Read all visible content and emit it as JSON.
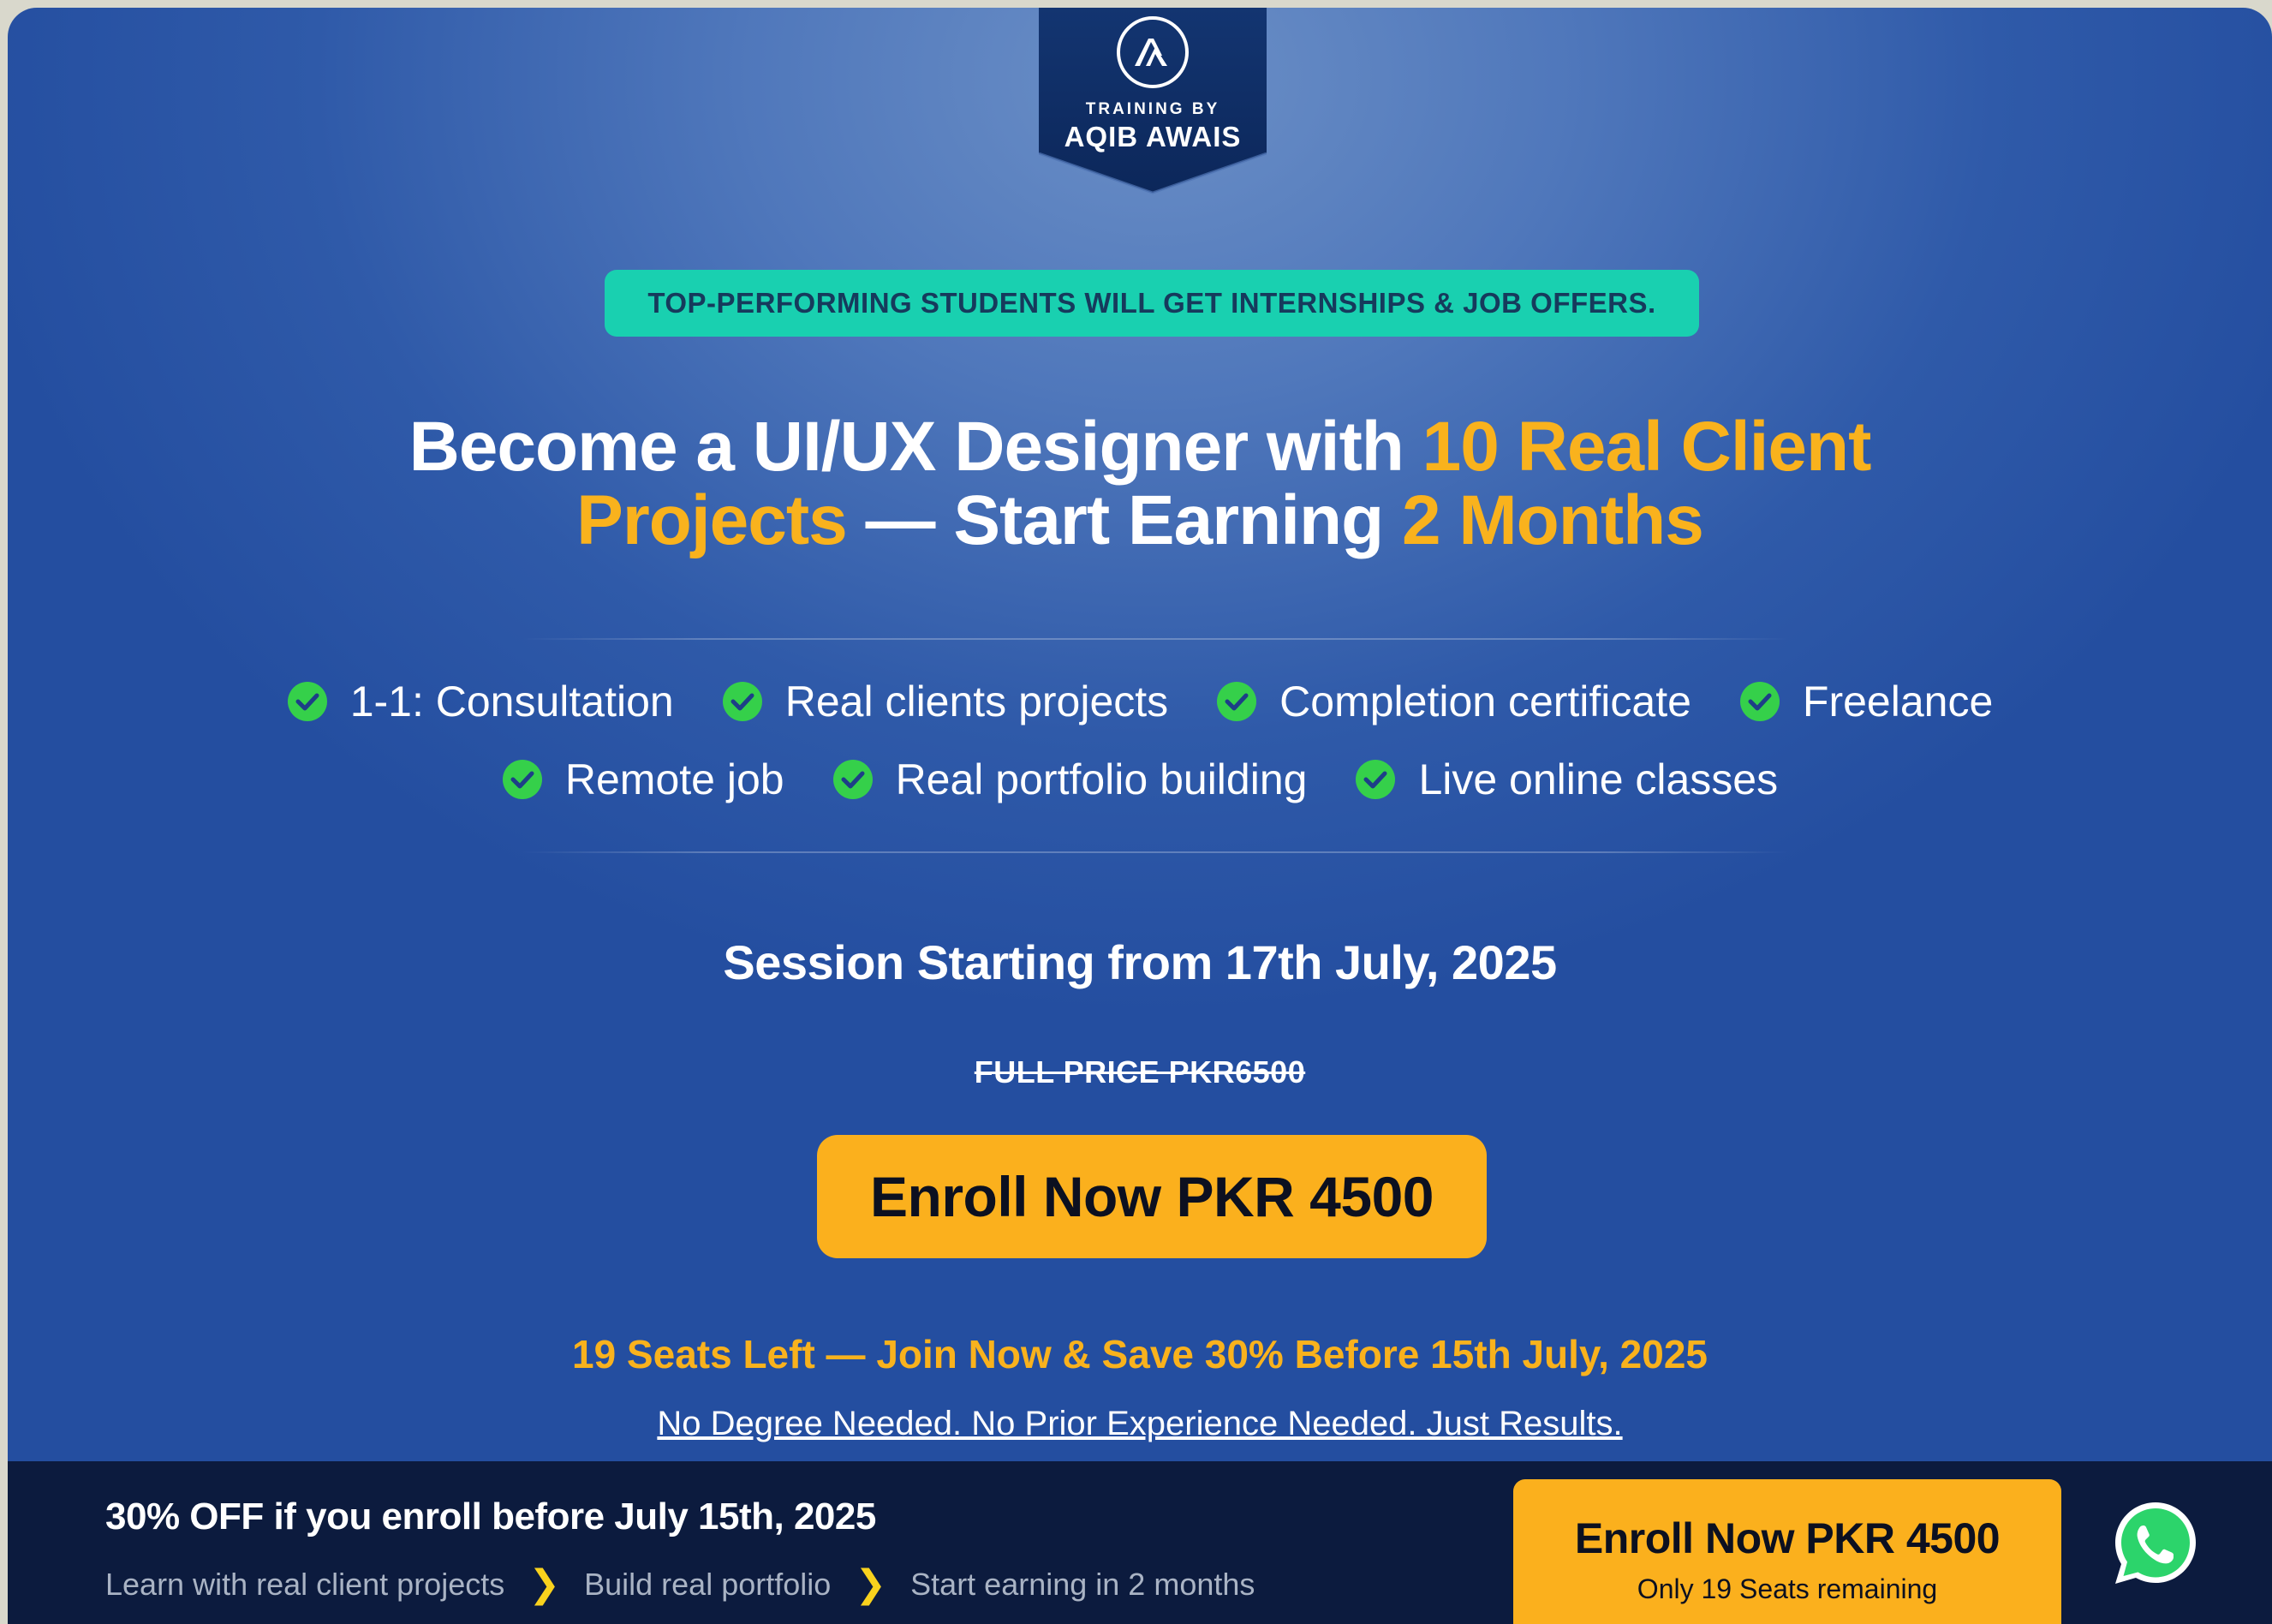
{
  "brand": {
    "small_text": "TRAINING BY",
    "name": "AQIB AWAIS",
    "logo_icon": "aqib-awais-logo-icon",
    "badge_color": "#0f2d64"
  },
  "announcement": "TOP-PERFORMING STUDENTS WILL GET INTERNSHIPS & JOB OFFERS.",
  "headline": {
    "part1": "Become a UI/UX Designer with ",
    "highlight1": "10 Real Client",
    "highlight2": "Projects",
    "part2": " — Start Earning ",
    "highlight3": "2 Months"
  },
  "features": {
    "row1": [
      {
        "label": "1-1: Consultation",
        "icon": "check-circle-icon"
      },
      {
        "label": "Real clients projects",
        "icon": "check-circle-icon"
      },
      {
        "label": "Completion certificate",
        "icon": "check-circle-icon"
      },
      {
        "label": "Freelance",
        "icon": "check-circle-icon"
      }
    ],
    "row2": [
      {
        "label": "Remote job",
        "icon": "check-circle-icon"
      },
      {
        "label": "Real portfolio building",
        "icon": "check-circle-icon"
      },
      {
        "label": "Live online classes",
        "icon": "check-circle-icon"
      }
    ]
  },
  "session": "Session Starting from 17th July, 2025",
  "full_price": "FULL PRICE PKR6500",
  "enroll_main_label": "Enroll Now PKR 4500",
  "seats_notice": "19 Seats Left — Join Now & Save 30% Before 15th July, 2025",
  "no_degree_link": "No Degree Needed. No Prior Experience Needed. Just Results.",
  "bottom_bar": {
    "title": "30% OFF if you enroll before July 15th, 2025",
    "steps": [
      "Learn with real client projects",
      "Build real portfolio",
      "Start earning in 2 months"
    ],
    "step_separator_icon": "chevron-right-icon",
    "enroll_label": "Enroll Now PKR 4500",
    "enroll_sub": "Only 19 Seats remaining",
    "whatsapp_icon": "whatsapp-icon"
  },
  "colors": {
    "accent": "#f9b21d",
    "button": "#fbb01d",
    "pill": "#19d0b0",
    "check": "#35d04a",
    "bar_bg": "#0c1b3e",
    "whatsapp": "#2cd46b"
  }
}
